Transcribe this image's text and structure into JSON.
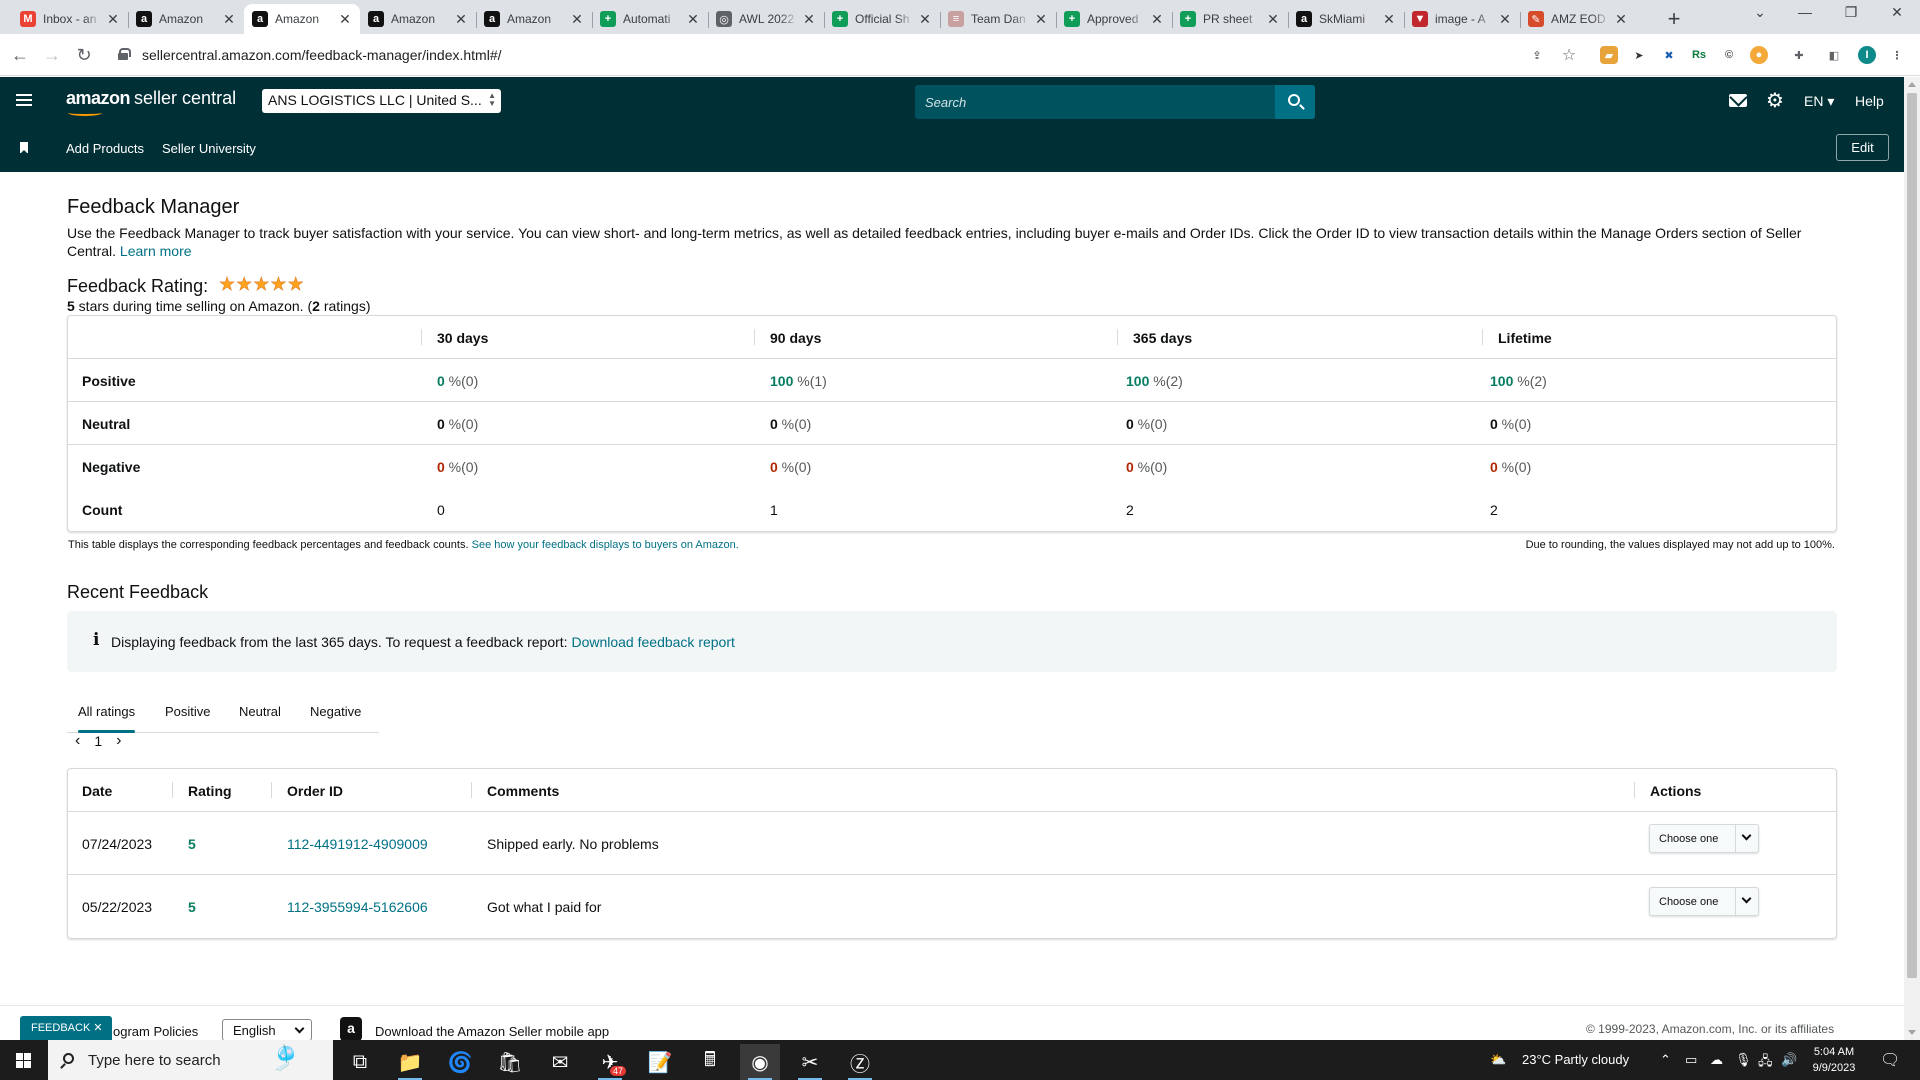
{
  "browser": {
    "tabs": [
      {
        "title": "Inbox - an",
        "icon": "gmail-icon",
        "color": "#ea4335",
        "glyph": "M"
      },
      {
        "title": "Amazon",
        "icon": "amazon-a-icon",
        "color": "#111111",
        "glyph": "a"
      },
      {
        "title": "Amazon",
        "icon": "amazon-a-icon",
        "color": "#111111",
        "glyph": "a"
      },
      {
        "title": "Amazon",
        "icon": "amazon-a-icon",
        "color": "#111111",
        "glyph": "a"
      },
      {
        "title": "Amazon",
        "icon": "amazon-a-icon",
        "color": "#111111",
        "glyph": "a"
      },
      {
        "title": "Automati",
        "icon": "sheets-icon",
        "color": "#0f9d58",
        "glyph": "+"
      },
      {
        "title": "AWL 2022",
        "icon": "globe-icon",
        "color": "#5f6368",
        "glyph": "◎"
      },
      {
        "title": "Official Sh",
        "icon": "sheets-icon",
        "color": "#0f9d58",
        "glyph": "+"
      },
      {
        "title": "Team Dan",
        "icon": "sheets-lite-icon",
        "color": "#c9a0a0",
        "glyph": "≡"
      },
      {
        "title": "Approved",
        "icon": "sheets-icon",
        "color": "#0f9d58",
        "glyph": "+"
      },
      {
        "title": "PR sheet",
        "icon": "sheets-icon",
        "color": "#0f9d58",
        "glyph": "+"
      },
      {
        "title": "SkMiami",
        "icon": "amazon-a-icon",
        "color": "#111111",
        "glyph": "a"
      },
      {
        "title": "image - A",
        "icon": "vivaldi-icon",
        "color": "#c0282d",
        "glyph": "▼"
      },
      {
        "title": "AMZ EOD",
        "icon": "ai-icon",
        "color": "#d64b2a",
        "glyph": "✎"
      }
    ],
    "active_tab": 2,
    "url": "sellercentral.amazon.com/feedback-manager/index.html#/",
    "new_tab": "+",
    "close": "✕"
  },
  "header": {
    "logo_bold": "amazon",
    "logo_rest": "seller central",
    "account": "ANS LOGISTICS LLC | United S...",
    "search_placeholder": "Search",
    "language": "EN ▾",
    "help": "Help"
  },
  "subnav": {
    "links": [
      "Add Products",
      "Seller University"
    ],
    "edit": "Edit"
  },
  "page": {
    "title": "Feedback Manager",
    "intro": "Use the Feedback Manager to track buyer satisfaction with your service. You can view short- and long-term metrics, as well as detailed feedback entries, including buyer e-mails and Order IDs. Click the Order ID to view transaction details within the Manage Orders section of Seller Central.",
    "learn_more": "Learn more",
    "rating_label": "Feedback Rating:",
    "stars": 5,
    "rating_stars": "5",
    "rating_mid": " stars during time selling on Amazon. (",
    "rating_count": "2",
    "rating_end": " ratings)"
  },
  "metrics": {
    "columns": [
      "30 days",
      "90 days",
      "365 days",
      "Lifetime"
    ],
    "rows": [
      {
        "label": "Positive",
        "tone": "g",
        "cells": [
          {
            "v": "0",
            "p": " %(0)"
          },
          {
            "v": "100",
            "p": " %(1)"
          },
          {
            "v": "100",
            "p": " %(2)"
          },
          {
            "v": "100",
            "p": " %(2)"
          }
        ]
      },
      {
        "label": "Neutral",
        "tone": "n",
        "cells": [
          {
            "v": "0",
            "p": " %(0)"
          },
          {
            "v": "0",
            "p": " %(0)"
          },
          {
            "v": "0",
            "p": " %(0)"
          },
          {
            "v": "0",
            "p": " %(0)"
          }
        ]
      },
      {
        "label": "Negative",
        "tone": "r",
        "cells": [
          {
            "v": "0",
            "p": " %(0)"
          },
          {
            "v": "0",
            "p": " %(0)"
          },
          {
            "v": "0",
            "p": " %(0)"
          },
          {
            "v": "0",
            "p": " %(0)"
          }
        ]
      }
    ],
    "count_label": "Count",
    "counts": [
      "0",
      "1",
      "2",
      "2"
    ],
    "note_left": "This table displays the corresponding feedback percentages and feedback counts.",
    "note_link": "See how your feedback displays to buyers on Amazon.",
    "note_right": "Due to rounding, the values displayed may not add up to 100%."
  },
  "recent": {
    "title": "Recent Feedback",
    "info_icon": "i",
    "info_text": "Displaying feedback from the last 365 days. To request a feedback report:",
    "info_link": "Download feedback report",
    "filters": [
      "All ratings",
      "Positive",
      "Neutral",
      "Negative"
    ],
    "active_filter": 0,
    "pager": {
      "prev": "‹",
      "page": "1",
      "next": "›"
    },
    "columns": [
      "Date",
      "Rating",
      "Order ID",
      "Comments",
      "Actions"
    ],
    "rows": [
      {
        "date": "07/24/2023",
        "rating": "5",
        "order_id": "112-4491912-4909009",
        "comment": "Shipped early. No problems",
        "action": "Choose one"
      },
      {
        "date": "05/22/2023",
        "rating": "5",
        "order_id": "112-3955994-5162606",
        "comment": "Got what I paid for",
        "action": "Choose one"
      }
    ]
  },
  "footer": {
    "feedback_tag": "FEEDBACK ✕",
    "policies": "ogram Policies",
    "language": "English",
    "app": "Download the Amazon Seller mobile app",
    "copyright": "© 1999-2023, Amazon.com, Inc. or its affiliates"
  },
  "taskbar": {
    "search_placeholder": "Type here to search",
    "weather": "23°C  Partly cloudy",
    "time": "5:04 AM",
    "date": "9/9/2023",
    "badge": "47"
  }
}
